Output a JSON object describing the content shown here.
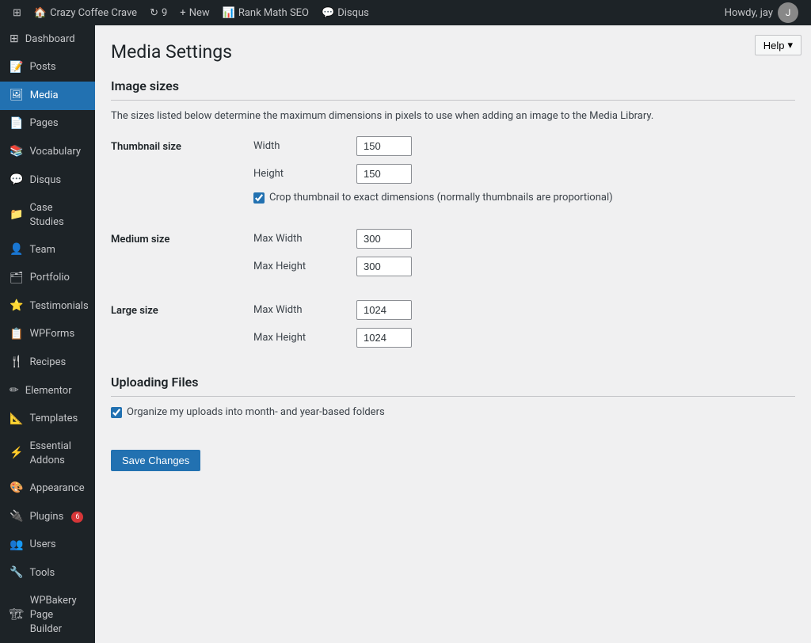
{
  "adminBar": {
    "items": [
      {
        "id": "wp-logo",
        "icon": "⊞",
        "label": ""
      },
      {
        "id": "site-name",
        "icon": "🏠",
        "label": "Crazy Coffee Crave"
      },
      {
        "id": "updates",
        "icon": "↻",
        "label": "9"
      },
      {
        "id": "new",
        "icon": "+",
        "label": "New"
      },
      {
        "id": "rank-math",
        "icon": "📊",
        "label": "Rank Math SEO"
      },
      {
        "id": "disqus",
        "icon": "💬",
        "label": "Disqus"
      }
    ],
    "howdy": "Howdy, jay"
  },
  "sidebar": {
    "items": [
      {
        "id": "dashboard",
        "icon": "⊞",
        "label": "Dashboard"
      },
      {
        "id": "posts",
        "icon": "📝",
        "label": "Posts"
      },
      {
        "id": "media",
        "icon": "🖼",
        "label": "Media",
        "active": true
      },
      {
        "id": "pages",
        "icon": "📄",
        "label": "Pages"
      },
      {
        "id": "vocabulary",
        "icon": "📚",
        "label": "Vocabulary"
      },
      {
        "id": "disqus",
        "icon": "💬",
        "label": "Disqus"
      },
      {
        "id": "case-studies",
        "icon": "📁",
        "label": "Case Studies"
      },
      {
        "id": "team",
        "icon": "👤",
        "label": "Team"
      },
      {
        "id": "portfolio",
        "icon": "🗂",
        "label": "Portfolio"
      },
      {
        "id": "testimonials",
        "icon": "⭐",
        "label": "Testimonials"
      },
      {
        "id": "wpforms",
        "icon": "📋",
        "label": "WPForms"
      },
      {
        "id": "recipes",
        "icon": "🍴",
        "label": "Recipes"
      },
      {
        "id": "elementor",
        "icon": "✏",
        "label": "Elementor"
      },
      {
        "id": "templates",
        "icon": "📐",
        "label": "Templates"
      },
      {
        "id": "essential-addons",
        "icon": "⚡",
        "label": "Essential Addons"
      },
      {
        "id": "appearance",
        "icon": "🎨",
        "label": "Appearance"
      },
      {
        "id": "plugins",
        "icon": "🔌",
        "label": "Plugins",
        "badge": "6"
      },
      {
        "id": "users",
        "icon": "👥",
        "label": "Users"
      },
      {
        "id": "tools",
        "icon": "🔧",
        "label": "Tools"
      },
      {
        "id": "wpbakery",
        "icon": "🏗",
        "label": "WPBakery Page Builder"
      }
    ]
  },
  "page": {
    "title": "Media Settings",
    "helpLabel": "Help",
    "imageSizes": {
      "heading": "Image sizes",
      "description": "The sizes listed below determine the maximum dimensions in pixels to use when adding an image to the Media Library.",
      "thumbnail": {
        "label": "Thumbnail size",
        "widthLabel": "Width",
        "widthValue": "150",
        "heightLabel": "Height",
        "heightValue": "150",
        "cropLabel": "Crop thumbnail to exact dimensions (normally thumbnails are proportional)",
        "cropChecked": true
      },
      "medium": {
        "label": "Medium size",
        "maxWidthLabel": "Max Width",
        "maxWidthValue": "300",
        "maxHeightLabel": "Max Height",
        "maxHeightValue": "300"
      },
      "large": {
        "label": "Large size",
        "maxWidthLabel": "Max Width",
        "maxWidthValue": "1024",
        "maxHeightLabel": "Max Height",
        "maxHeightValue": "1024"
      }
    },
    "uploadingFiles": {
      "heading": "Uploading Files",
      "organizeLabel": "Organize my uploads into month- and year-based folders",
      "organizeChecked": true
    },
    "saveLabel": "Save Changes"
  }
}
